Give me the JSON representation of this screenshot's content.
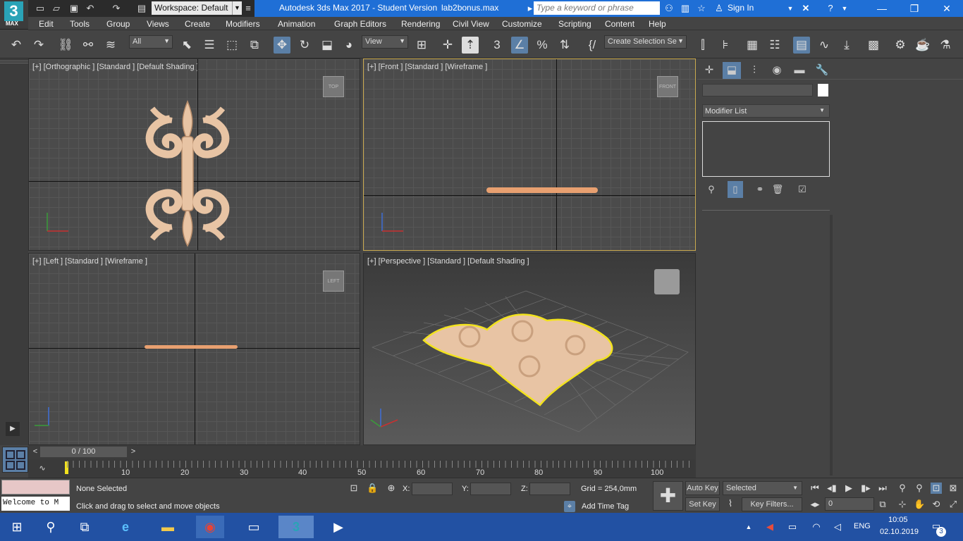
{
  "titlebar": {
    "workspace_label": "Workspace: Default",
    "app_title": "Autodesk 3ds Max 2017 - Student Version",
    "file_title": "lab2bonus.max",
    "search_placeholder": "Type a keyword or phrase",
    "sign_in": "Sign In"
  },
  "logo": {
    "big": "3",
    "small": "MAX"
  },
  "menu": [
    "Edit",
    "Tools",
    "Group",
    "Views",
    "Create",
    "Modifiers",
    "Animation",
    "Graph Editors",
    "Rendering",
    "Civil View",
    "Customize",
    "Scripting",
    "Content",
    "Help"
  ],
  "toolbar": {
    "filter_select": "All",
    "view_select": "View",
    "named_selection": "Create Selection Se"
  },
  "viewports": {
    "top_left": {
      "label": "[+] [Orthographic ] [Standard ] [Default Shading ]",
      "cube": "TOP"
    },
    "top_right": {
      "label": "[+] [Front ] [Standard ] [Wireframe ]",
      "cube": "FRONT"
    },
    "bottom_left": {
      "label": "[+] [Left ] [Standard ] [Wireframe ]",
      "cube": "LEFT"
    },
    "bottom_right": {
      "label": "[+] [Perspective ] [Standard ] [Default Shading ]"
    }
  },
  "command_panel": {
    "modifier_list": "Modifier List"
  },
  "timeline": {
    "slider_label": "0 / 100",
    "ticks": [
      "10",
      "20",
      "30",
      "40",
      "50",
      "60",
      "70",
      "80",
      "90",
      "100"
    ]
  },
  "status": {
    "selection": "None Selected",
    "prompt": "Click and drag to select and move objects",
    "x_label": "X:",
    "y_label": "Y:",
    "z_label": "Z:",
    "grid": "Grid = 254,0mm",
    "add_time_tag": "Add Time Tag",
    "auto_key": "Auto Key",
    "set_key": "Set Key",
    "key_mode_select": "Selected",
    "key_filters": "Key Filters...",
    "frame_value": "0",
    "welcome": "Welcome to M"
  },
  "taskbar": {
    "lang": "ENG",
    "time": "10:05",
    "date": "02.10.2019",
    "notifications": "3"
  },
  "colors": {
    "title_blue": "#1f6fd6",
    "accent_blue": "#5b7fa6",
    "object_color": "#e8c4a4",
    "selection_highlight": "#f2e21e",
    "taskbar": "#2251a3"
  }
}
